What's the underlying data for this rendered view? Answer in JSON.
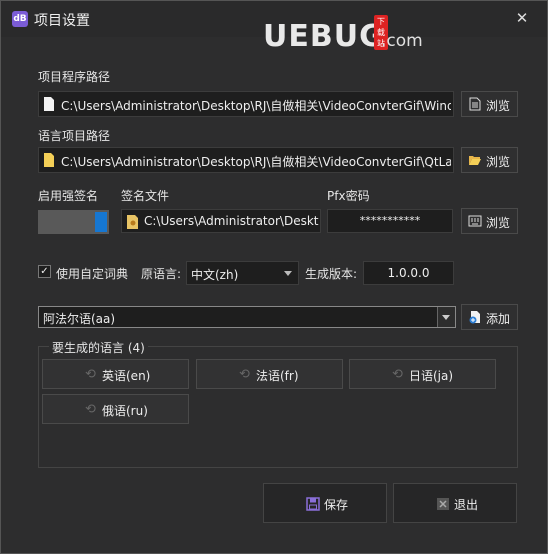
{
  "window": {
    "title": "项目设置",
    "app_icon_text": "dB",
    "close_glyph": "✕"
  },
  "watermark": {
    "main": "UEBUG",
    "suffix": ".com",
    "tag": "下载站"
  },
  "project_path": {
    "label": "项目程序路径",
    "value": "C:\\Users\\Administrator\\Desktop\\RJ\\自做相关\\VideoConvterGif\\Wind",
    "browse_label": "浏览"
  },
  "lang_project_path": {
    "label": "语言项目路径",
    "value": "C:\\Users\\Administrator\\Desktop\\RJ\\自做相关\\VideoConvterGif\\QtLa",
    "browse_label": "浏览"
  },
  "strong_name": {
    "label": "启用强签名",
    "enabled": true
  },
  "sign_file": {
    "label": "签名文件",
    "value": "C:\\Users\\Administrator\\Deskt"
  },
  "pfx": {
    "label": "Pfx密码",
    "value": "***********",
    "browse_label": "浏览"
  },
  "dictionary": {
    "checkbox_label": "使用自定词典",
    "checked": true,
    "checkmark": "✓"
  },
  "source_lang": {
    "label": "原语言:",
    "value": "中文(zh)"
  },
  "build_version": {
    "label": "生成版本:",
    "value": "1.0.0.0"
  },
  "language_select": {
    "value": "阿法尔语(aa)",
    "add_label": "添加"
  },
  "target_group": {
    "title": "要生成的语言 (4)",
    "languages": [
      "英语(en)",
      "法语(fr)",
      "日语(ja)",
      "俄语(ru)"
    ],
    "remove_icon": "⟲"
  },
  "actions": {
    "save_label": "保存",
    "exit_label": "退出"
  },
  "colors": {
    "accent": "#1677d2",
    "background": "#2d2d2e",
    "save_icon": "#8a6fd8"
  }
}
